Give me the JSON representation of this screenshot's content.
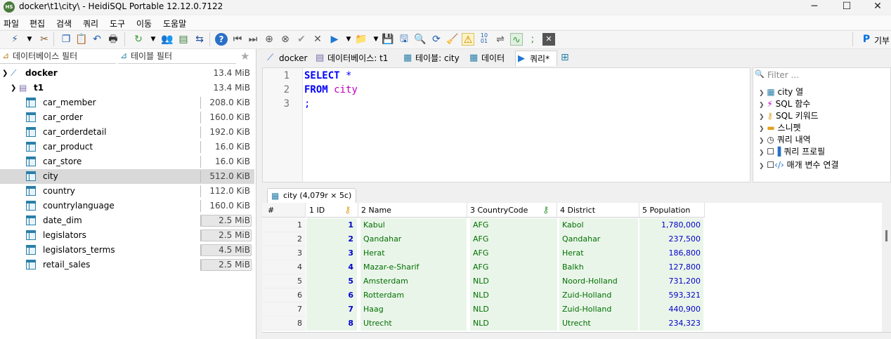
{
  "window": {
    "title": "docker\\t1\\city\\ - HeidiSQL Portable 12.12.0.7122",
    "app_icon": "HS",
    "controls": {
      "minimize": "─",
      "maximize": "☐",
      "close": "✕"
    }
  },
  "menu": [
    "파일",
    "편집",
    "검색",
    "쿼리",
    "도구",
    "이동",
    "도움말"
  ],
  "toolbar": {
    "right_label": "기부"
  },
  "filters": {
    "db_filter": "데이터베이스 필터",
    "table_filter": "테이블 필터"
  },
  "tree": {
    "server": {
      "name": "docker",
      "size": "13.4 MiB"
    },
    "database": {
      "name": "t1",
      "size": "13.4 MiB"
    },
    "tables": [
      {
        "name": "car_member",
        "size": "208.0 KiB",
        "fill": 0.01
      },
      {
        "name": "car_order",
        "size": "160.0 KiB",
        "fill": 0.01
      },
      {
        "name": "car_orderdetail",
        "size": "192.0 KiB",
        "fill": 0.01
      },
      {
        "name": "car_product",
        "size": "16.0 KiB",
        "fill": 0
      },
      {
        "name": "car_store",
        "size": "16.0 KiB",
        "fill": 0
      },
      {
        "name": "city",
        "size": "512.0 KiB",
        "fill": 0.04
      },
      {
        "name": "country",
        "size": "112.0 KiB",
        "fill": 0.01
      },
      {
        "name": "countrylanguage",
        "size": "160.0 KiB",
        "fill": 0.01
      },
      {
        "name": "date_dim",
        "size": "2.5 MiB",
        "fill": 0.19
      },
      {
        "name": "legislators",
        "size": "2.5 MiB",
        "fill": 0.19
      },
      {
        "name": "legislators_terms",
        "size": "4.5 MiB",
        "fill": 0.34
      },
      {
        "name": "retail_sales",
        "size": "2.5 MiB",
        "fill": 0.19
      }
    ],
    "selected": "city"
  },
  "tabs": [
    {
      "label": "docker",
      "icon": "server-icon"
    },
    {
      "label": "데이터베이스: t1",
      "icon": "database-icon"
    },
    {
      "label": "테이블: city",
      "icon": "table-icon"
    },
    {
      "label": "데이터",
      "icon": "grid-icon"
    },
    {
      "label": "쿼리*",
      "icon": "play-icon",
      "active": true
    }
  ],
  "editor": {
    "lines": [
      "1",
      "2",
      "3"
    ],
    "sql": {
      "select": "SELECT",
      "star": "*",
      "from": "FROM",
      "table": "city",
      "semicolon": ";"
    }
  },
  "helper": {
    "filter_placeholder": "Filter ...",
    "items": [
      "city 열",
      "SQL 함수",
      "SQL 키워드",
      "스니펫",
      "쿼리 내역",
      "쿼리 프로필",
      "매개 변수 연결"
    ]
  },
  "result": {
    "tab_label": "city (4,079r × 5c)",
    "columns": [
      "#",
      "1 ID",
      "2 Name",
      "3 CountryCode",
      "4 District",
      "5 Population"
    ],
    "rows": [
      {
        "n": "1",
        "id": "1",
        "name": "Kabul",
        "cc": "AFG",
        "district": "Kabol",
        "pop": "1,780,000"
      },
      {
        "n": "2",
        "id": "2",
        "name": "Qandahar",
        "cc": "AFG",
        "district": "Qandahar",
        "pop": "237,500"
      },
      {
        "n": "3",
        "id": "3",
        "name": "Herat",
        "cc": "AFG",
        "district": "Herat",
        "pop": "186,800"
      },
      {
        "n": "4",
        "id": "4",
        "name": "Mazar-e-Sharif",
        "cc": "AFG",
        "district": "Balkh",
        "pop": "127,800"
      },
      {
        "n": "5",
        "id": "5",
        "name": "Amsterdam",
        "cc": "NLD",
        "district": "Noord-Holland",
        "pop": "731,200"
      },
      {
        "n": "6",
        "id": "6",
        "name": "Rotterdam",
        "cc": "NLD",
        "district": "Zuid-Holland",
        "pop": "593,321"
      },
      {
        "n": "7",
        "id": "7",
        "name": "Haag",
        "cc": "NLD",
        "district": "Zuid-Holland",
        "pop": "440,900"
      },
      {
        "n": "8",
        "id": "8",
        "name": "Utrecht",
        "cc": "NLD",
        "district": "Utrecht",
        "pop": "234,323"
      }
    ]
  }
}
